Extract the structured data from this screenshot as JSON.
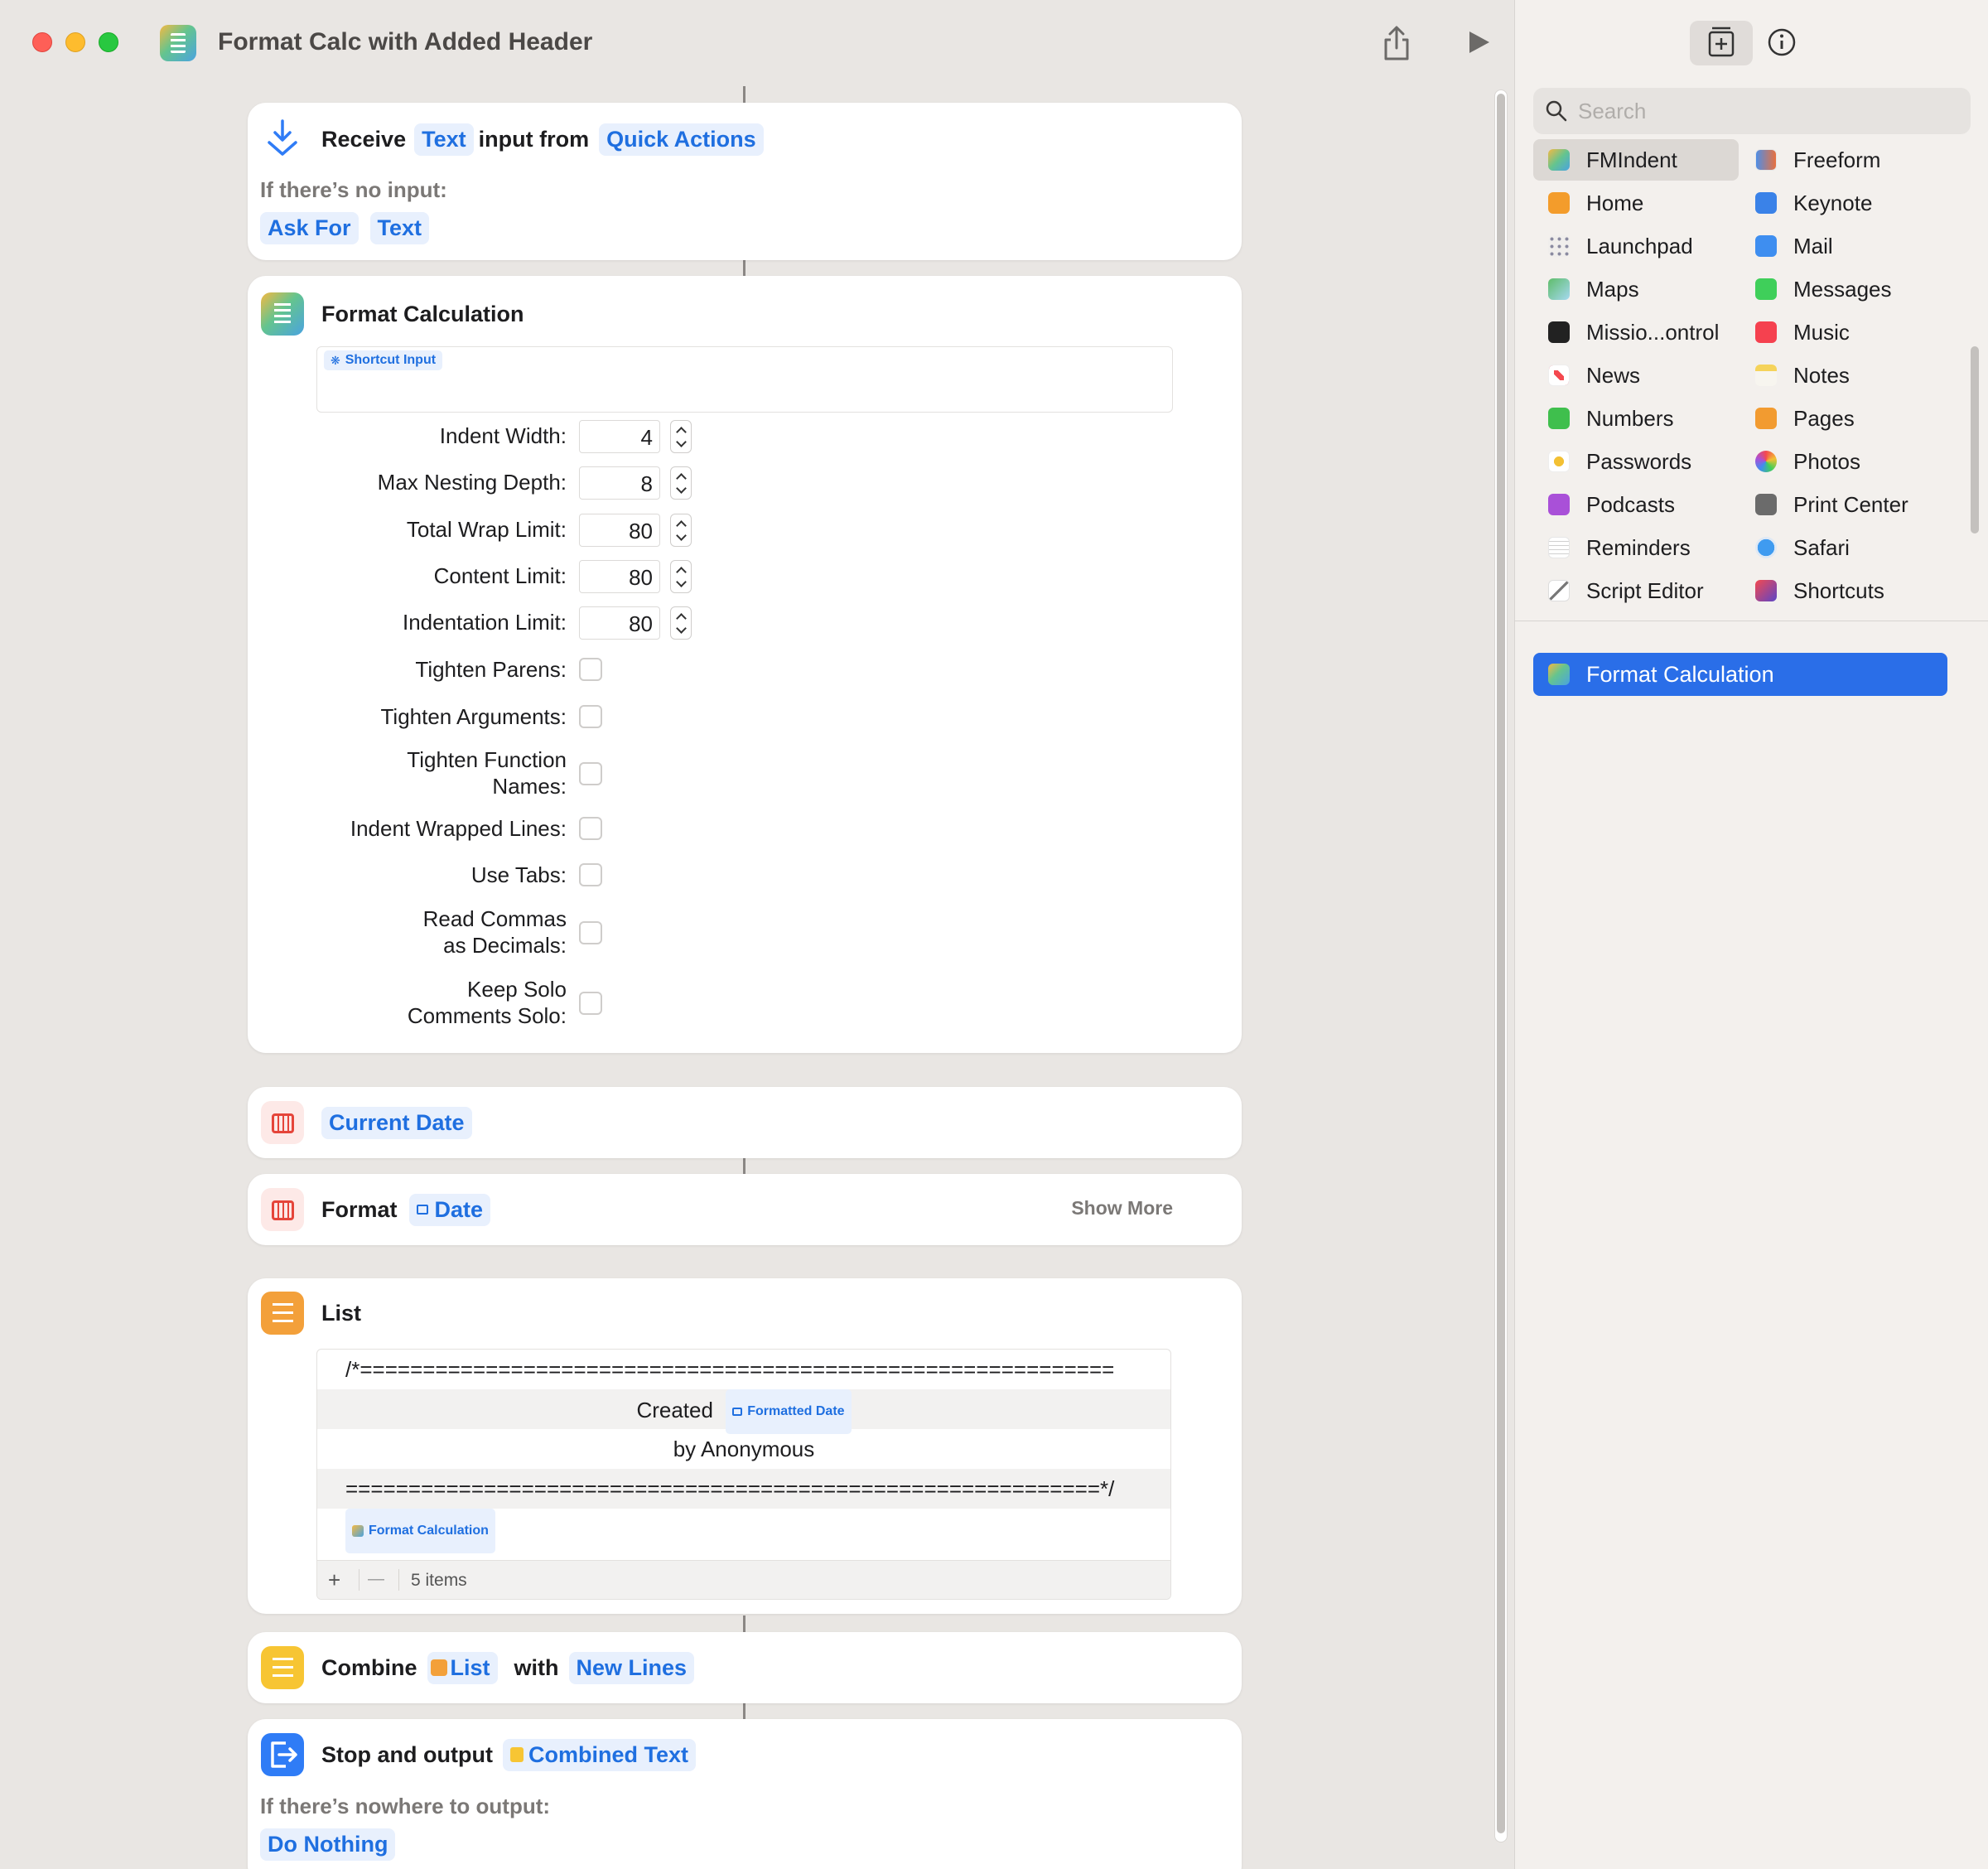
{
  "window": {
    "title": "Format Calc with Added Header"
  },
  "receive": {
    "verb": "Receive",
    "type_token": "Text",
    "middle": "input from",
    "source_token": "Quick Actions",
    "no_input_label": "If there’s no input:",
    "ask_token": "Ask For",
    "ask_type_token": "Text"
  },
  "format_calc": {
    "title": "Format Calculation",
    "input_token": "Shortcut Input",
    "fields": [
      {
        "label": "Indent Width:",
        "value": "4"
      },
      {
        "label": "Max Nesting Depth:",
        "value": "8"
      },
      {
        "label": "Total Wrap Limit:",
        "value": "80"
      },
      {
        "label": "Content Limit:",
        "value": "80"
      },
      {
        "label": "Indentation Limit:",
        "value": "80"
      }
    ],
    "checks": [
      {
        "label": "Tighten Parens:"
      },
      {
        "label": "Tighten Arguments:"
      },
      {
        "label_l1": "Tighten Function",
        "label_l2": "Names:"
      },
      {
        "label": "Indent Wrapped Lines:"
      },
      {
        "label": "Use Tabs:"
      },
      {
        "label_l1": "Read Commas",
        "label_l2": "as Decimals:"
      },
      {
        "label_l1": "Keep Solo",
        "label_l2": "Comments Solo:"
      }
    ]
  },
  "current_date": {
    "token": "Current Date"
  },
  "format_date": {
    "verb": "Format",
    "token": "Date",
    "show_more": "Show More"
  },
  "list": {
    "title": "List",
    "items": [
      "/*============================================================",
      "Created",
      "by Anonymous",
      "============================================================*/"
    ],
    "created_token": "Formatted Date",
    "calc_token": "Format Calculation",
    "plus": "+",
    "minus": "—",
    "count": "5 items"
  },
  "combine": {
    "verb": "Combine",
    "list_token": "List",
    "middle": "with",
    "sep_token": "New Lines"
  },
  "stop": {
    "verb": "Stop and output",
    "token": "Combined Text",
    "nowhere_label": "If there’s nowhere to output:",
    "nothing_token": "Do Nothing"
  },
  "sidebar": {
    "search_placeholder": "Search",
    "apps_left": [
      {
        "name": "FMIndent",
        "color": "#5fb9c9"
      },
      {
        "name": "Home",
        "color": "#f39c2b"
      },
      {
        "name": "Launchpad",
        "color": "#8a8aa0"
      },
      {
        "name": "Maps",
        "color": "#5fbd6a"
      },
      {
        "name": "Missio...ontrol",
        "color": "#222222"
      },
      {
        "name": "News",
        "color": "#f4494f"
      },
      {
        "name": "Numbers",
        "color": "#3fbf4d"
      },
      {
        "name": "Passwords",
        "color": "#f3c033"
      },
      {
        "name": "Podcasts",
        "color": "#a950d8"
      },
      {
        "name": "Reminders",
        "color": "#e6e6e6"
      },
      {
        "name": "Script Editor",
        "color": "#9a9a9a"
      }
    ],
    "apps_right": [
      {
        "name": "Freeform",
        "color": "#4f8ee6"
      },
      {
        "name": "Keynote",
        "color": "#3a82e8"
      },
      {
        "name": "Mail",
        "color": "#3e8ef0"
      },
      {
        "name": "Messages",
        "color": "#3fcf5a"
      },
      {
        "name": "Music",
        "color": "#f5414f"
      },
      {
        "name": "Notes",
        "color": "#f5d35a"
      },
      {
        "name": "Pages",
        "color": "#f29b30"
      },
      {
        "name": "Photos",
        "color": "#e8703f"
      },
      {
        "name": "Print Center",
        "color": "#6b6b6b"
      },
      {
        "name": "Safari",
        "color": "#3f9bf0"
      },
      {
        "name": "Shortcuts",
        "color": "#5c45c7"
      }
    ],
    "selected_action": "Format Calculation"
  },
  "colors": {
    "accent": "#2a6ee8",
    "token_text": "#1f6fe0",
    "token_bg": "#e8f0fd"
  }
}
